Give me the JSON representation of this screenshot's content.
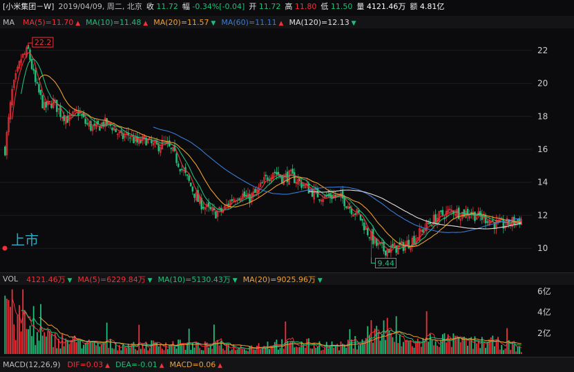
{
  "quote": {
    "name": "[小米集团－W]",
    "date": "2019/04/09, 周二, 北京",
    "close_label": "收",
    "close": "11.72",
    "change_label": "幅",
    "change_pct": "-0.34%",
    "change_abs": "[-0.04]",
    "open_label": "开",
    "open": "11.72",
    "high_label": "高",
    "high": "11.80",
    "low_label": "低",
    "low": "11.50",
    "volume_label": "量",
    "volume": "4121.46万",
    "amount_label": "额",
    "amount": "4.81亿"
  },
  "ma_legend": {
    "label": "MA",
    "items": [
      {
        "text": "MA(5)=11.70",
        "color": "#f0313a",
        "dir": "up"
      },
      {
        "text": "MA(10)=11.48",
        "color": "#1fbf7a",
        "dir": "up"
      },
      {
        "text": "MA(20)=11.57",
        "color": "#f0a030",
        "dir": "down"
      },
      {
        "text": "MA(60)=11.11",
        "color": "#3a7bd5",
        "dir": "up"
      },
      {
        "text": "MA(120)=12.13",
        "color": "#e0e0e0",
        "dir": "down"
      }
    ]
  },
  "vol_legend": {
    "label": "VOL",
    "items": [
      {
        "text": "4121.46万",
        "color": "#f0313a",
        "dir": "down"
      },
      {
        "text": "MA(5)=6229.84万",
        "color": "#f0313a",
        "dir": "down"
      },
      {
        "text": "MA(10)=5130.43万",
        "color": "#1fbf7a",
        "dir": "down"
      },
      {
        "text": "MA(20)=9025.96万",
        "color": "#f0a030",
        "dir": "down"
      }
    ]
  },
  "macd_legend": {
    "label": "MACD(12,26,9)",
    "items": [
      {
        "text": "DIF=0.03",
        "color": "#f0313a",
        "dir": "up"
      },
      {
        "text": "DEA=-0.01",
        "color": "#1fbf7a",
        "dir": "up"
      },
      {
        "text": "MACD=0.06",
        "color": "#f0a030",
        "dir": "up"
      }
    ]
  },
  "price_axis": {
    "ticks": [
      "22",
      "20",
      "18",
      "16",
      "14",
      "12",
      "10"
    ],
    "max_label": "22.2",
    "min_label": "9.44",
    "listing_label": "上市"
  },
  "vol_axis": {
    "ticks": [
      "6亿",
      "4亿",
      "2亿"
    ]
  },
  "colors": {
    "up": "#f0313a",
    "down": "#1fbf7a",
    "ma5": "#f0313a",
    "ma10": "#1fbf7a",
    "ma20": "#f0a030",
    "ma60": "#3a7bd5",
    "ma120": "#e0e0e0",
    "axis_text": "#cfcfcf"
  },
  "chart_data": {
    "type": "candlestick",
    "ylim": [
      9.0,
      23.0
    ],
    "anchors": [
      [
        0,
        16.0
      ],
      [
        4,
        19.5
      ],
      [
        9,
        21.5
      ],
      [
        13,
        22.0
      ],
      [
        17,
        20.0
      ],
      [
        22,
        18.5
      ],
      [
        27,
        18.9
      ],
      [
        31,
        18.2
      ],
      [
        36,
        17.8
      ],
      [
        41,
        18.3
      ],
      [
        45,
        17.6
      ],
      [
        50,
        17.2
      ],
      [
        55,
        17.6
      ],
      [
        60,
        17.4
      ],
      [
        65,
        16.7
      ],
      [
        69,
        16.9
      ],
      [
        74,
        16.4
      ],
      [
        79,
        16.6
      ],
      [
        84,
        16.1
      ],
      [
        89,
        16.4
      ],
      [
        94,
        15.8
      ],
      [
        98,
        15.0
      ],
      [
        103,
        14.0
      ],
      [
        108,
        12.9
      ],
      [
        113,
        12.4
      ],
      [
        117,
        12.1
      ],
      [
        122,
        12.3
      ],
      [
        127,
        13.0
      ],
      [
        132,
        13.3
      ],
      [
        136,
        13.0
      ],
      [
        141,
        13.4
      ],
      [
        146,
        14.2
      ],
      [
        150,
        14.7
      ],
      [
        155,
        14.3
      ],
      [
        160,
        14.4
      ],
      [
        165,
        14.0
      ],
      [
        170,
        13.6
      ],
      [
        174,
        13.3
      ],
      [
        179,
        13.1
      ],
      [
        184,
        13.2
      ],
      [
        189,
        13.0
      ],
      [
        193,
        12.5
      ],
      [
        198,
        12.0
      ],
      [
        203,
        11.0
      ],
      [
        208,
        10.2
      ],
      [
        212,
        9.9
      ],
      [
        217,
        10.0
      ],
      [
        222,
        10.1
      ],
      [
        227,
        10.4
      ],
      [
        232,
        10.9
      ],
      [
        236,
        11.4
      ],
      [
        241,
        11.8
      ],
      [
        246,
        12.1
      ],
      [
        251,
        12.3
      ],
      [
        255,
        12.1
      ],
      [
        260,
        12.2
      ],
      [
        265,
        11.9
      ],
      [
        270,
        11.8
      ],
      [
        274,
        11.5
      ],
      [
        279,
        11.4
      ],
      [
        284,
        11.6
      ],
      [
        289,
        11.72
      ]
    ],
    "volume_anchors": [
      [
        0,
        5.8
      ],
      [
        3,
        4.5
      ],
      [
        6,
        2.5
      ],
      [
        10,
        3.1
      ],
      [
        14,
        2.0
      ],
      [
        20,
        1.5
      ],
      [
        30,
        1.3
      ],
      [
        40,
        1.1
      ],
      [
        50,
        0.8
      ],
      [
        60,
        0.9
      ],
      [
        70,
        0.7
      ],
      [
        80,
        0.8
      ],
      [
        90,
        0.9
      ],
      [
        100,
        0.8
      ],
      [
        110,
        0.7
      ],
      [
        120,
        0.8
      ],
      [
        130,
        0.6
      ],
      [
        140,
        0.7
      ],
      [
        150,
        1.0
      ],
      [
        160,
        0.8
      ],
      [
        170,
        0.9
      ],
      [
        180,
        0.8
      ],
      [
        190,
        0.7
      ],
      [
        200,
        1.3
      ],
      [
        205,
        2.2
      ],
      [
        210,
        1.7
      ],
      [
        220,
        1.2
      ],
      [
        230,
        1.0
      ],
      [
        240,
        1.4
      ],
      [
        250,
        1.2
      ],
      [
        260,
        1.0
      ],
      [
        270,
        1.1
      ],
      [
        280,
        0.9
      ],
      [
        289,
        0.41
      ]
    ],
    "ma120_start": 170,
    "ma60_start": 83,
    "max_point": {
      "index": 13,
      "value": 22.2
    },
    "min_point": {
      "index": 205,
      "value": 9.44
    }
  }
}
